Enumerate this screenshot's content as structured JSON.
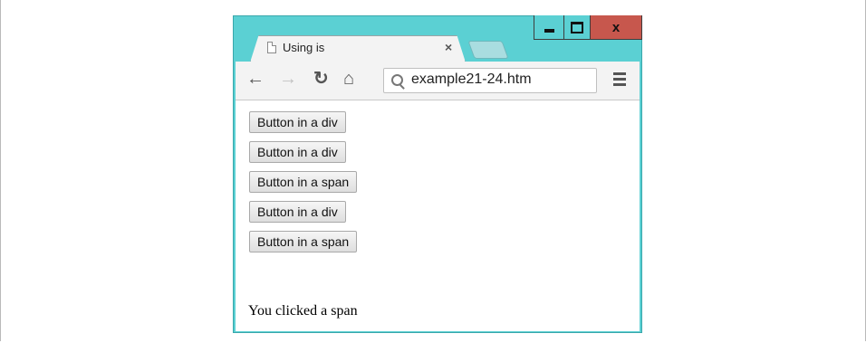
{
  "tab": {
    "title": "Using is",
    "close_glyph": "×"
  },
  "window_controls": {
    "close_glyph": "x"
  },
  "toolbar": {
    "back_icon": "back-arrow-icon",
    "forward_icon": "forward-arrow-icon",
    "reload_icon": "reload-icon",
    "home_icon": "home-icon",
    "url": "example21-24.htm",
    "menu_icon": "hamburger-menu-icon"
  },
  "buttons": [
    "Button in a div",
    "Button in a div",
    "Button in a span",
    "Button in a div",
    "Button in a span"
  ],
  "status_text": "You clicked a span",
  "colors": {
    "frame": "#5bd0d3",
    "close": "#c7574d"
  }
}
